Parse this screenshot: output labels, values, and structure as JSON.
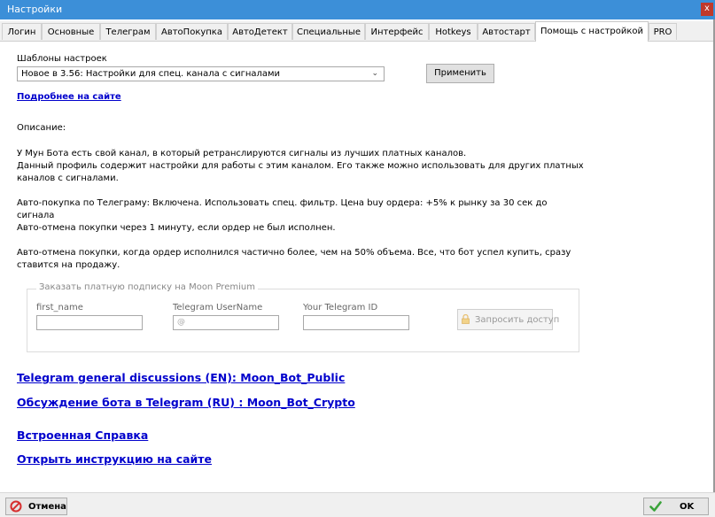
{
  "window": {
    "title": "Настройки",
    "close_label": "x"
  },
  "tabs": [
    {
      "label": "Логин"
    },
    {
      "label": "Основные"
    },
    {
      "label": "Телеграм"
    },
    {
      "label": "АвтоПокупка"
    },
    {
      "label": "АвтоДетект"
    },
    {
      "label": "Специальные"
    },
    {
      "label": "Интерфейс"
    },
    {
      "label": "Hotkeys"
    },
    {
      "label": "Автостарт"
    },
    {
      "label": "Помощь с настройкой",
      "active": true
    },
    {
      "label": "PRO"
    }
  ],
  "templates": {
    "label": "Шаблоны настроек",
    "selected": "Новое в 3.56: Настройки для спец. канала с сигналами",
    "apply_label": "Применить",
    "more_link": "Подробнее на сайте"
  },
  "description": {
    "heading": "Описание:",
    "p1_line1": "У Мун Бота есть свой канал, в который ретранслируются сигналы из лучших платных каналов.",
    "p1_line2": "Данный профиль содержит настройки для работы с этим каналом. Его также можно использовать для других платных каналов с сигналами.",
    "p2": "Авто-покупка по Телеграму: Включена. Использовать спец. фильтр. Цена buy ордера: +5% к рынку за 30 сек до сигнала",
    "p3": "Авто-отмена покупки через 1 минуту, если ордер не был исполнен.",
    "p4": "Авто-отмена покупки, когда ордер исполнился частично более, чем на 50% объема. Все, что бот успел купить, сразу ставится на продажу."
  },
  "premium": {
    "legend": "Заказать платную подписку на Moon Premium",
    "first_name_label": "first_name",
    "first_name_value": "",
    "username_label": "Telegram UserName",
    "username_placeholder": "@",
    "telegram_id_label": "Your Telegram ID",
    "telegram_id_value": "",
    "request_label": "Запросить доступ"
  },
  "links": {
    "en_discussion": "Telegram general discussions (EN): Moon_Bot_Public",
    "ru_discussion": "Обсуждение бота в Telegram (RU) : Moon_Bot_Crypto",
    "help": "Встроенная Справка",
    "instructions": "Открыть инструкцию на сайте"
  },
  "footer": {
    "cancel_label": "Отмена",
    "ok_label": "OK"
  },
  "colors": {
    "titlebar": "#3c8fd8",
    "link": "#0000cc",
    "cancel_icon": "#d62f2f",
    "ok_icon": "#3aa33a"
  }
}
